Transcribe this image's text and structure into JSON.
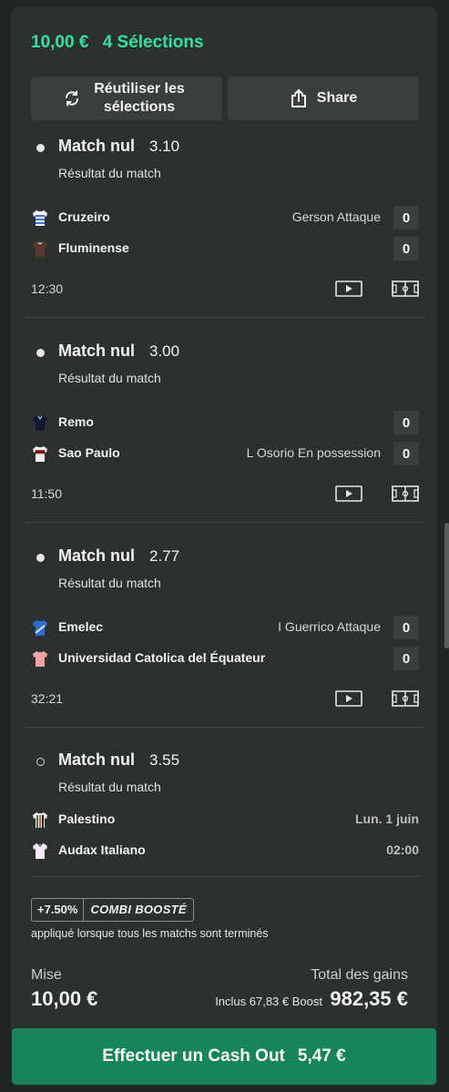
{
  "header": {
    "stake": "10,00 €",
    "selections": "4 Sélections"
  },
  "buttons": {
    "reuse": "Réutiliser les sélections",
    "share": "Share"
  },
  "selections": [
    {
      "pick": "Match nul",
      "odds": "3.10",
      "market": "Résultat du match",
      "settled": true,
      "teams": [
        {
          "name": "Cruzeiro",
          "action": "Gerson Attaque",
          "score": "0"
        },
        {
          "name": "Fluminense",
          "action": "",
          "score": "0"
        }
      ],
      "clock": "12:30"
    },
    {
      "pick": "Match nul",
      "odds": "3.00",
      "market": "Résultat du match",
      "settled": true,
      "teams": [
        {
          "name": "Remo",
          "action": "",
          "score": "0"
        },
        {
          "name": "Sao Paulo",
          "action": "L Osorio En possession",
          "score": "0"
        }
      ],
      "clock": "11:50"
    },
    {
      "pick": "Match nul",
      "odds": "2.77",
      "market": "Résultat du match",
      "settled": true,
      "teams": [
        {
          "name": "Emelec",
          "action": "I Guerrico Attaque",
          "score": "0"
        },
        {
          "name": "Universidad Catolica del Équateur",
          "action": "",
          "score": "0"
        }
      ],
      "clock": "32:21"
    },
    {
      "pick": "Match nul",
      "odds": "3.55",
      "market": "Résultat du match",
      "settled": false,
      "teams": [
        {
          "name": "Palestino",
          "date": "Lun. 1 juin"
        },
        {
          "name": "Audax Italiano",
          "date": "02:00"
        }
      ]
    }
  ],
  "boost": {
    "percent": "+7.50%",
    "label": "COMBI BOOSTÉ",
    "note": "appliqué lorsque tous les matchs sont terminés"
  },
  "summary": {
    "stake_label": "Mise",
    "stake_value": "10,00 €",
    "gain_label": "Total des gains",
    "boost_included": "Inclus 67,83 € Boost",
    "gain_value": "982,35 €"
  },
  "cashout": {
    "label": "Effectuer un Cash Out",
    "amount": "5,47 €"
  },
  "colors": {
    "accent": "#2ee59d",
    "cashout": "#16855b",
    "background": "#2c312f"
  }
}
